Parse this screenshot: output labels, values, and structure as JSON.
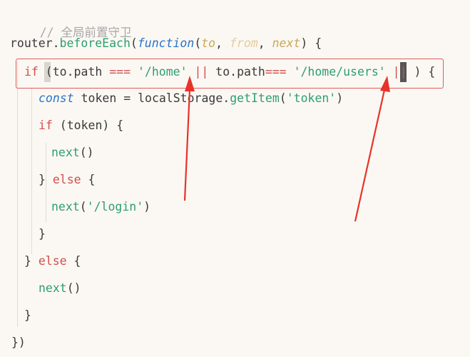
{
  "code": {
    "comment": "// 全局前置守卫",
    "line_router": {
      "obj": "router",
      "dot": ".",
      "method": "beforeEach",
      "open": "(",
      "fnkw": "function",
      "open2": "(",
      "p_to": "to",
      "comma1": ", ",
      "p_from": "from",
      "comma2": ", ",
      "p_next": "next",
      "close": ") {"
    },
    "line_if": {
      "kw": "if",
      "open": " (to.path ",
      "op1": "===",
      "sp1": " ",
      "s1": "'/home'",
      "sp2": " ",
      "or1": "||",
      "mid": " to.path",
      "op2": "===",
      "sp3": " ",
      "s2": "'/home/users'",
      "sp4": " ",
      "or2": "||",
      "close": " ) {"
    },
    "line_const": {
      "kw": "const",
      "rest": " token = localStorage.",
      "call": "getItem",
      "open": "(",
      "str": "'token'",
      "close": ")"
    },
    "line_if2": {
      "kw": "if",
      "rest": " (token) {"
    },
    "line_next1": {
      "call": "next",
      "rest": "()"
    },
    "line_else1": {
      "brace": "} ",
      "kw": "else",
      "rest": " {"
    },
    "line_next2": {
      "call": "next",
      "open": "(",
      "str": "'/login'",
      "close": ")"
    },
    "line_close1": "}",
    "line_else2": {
      "brace": "} ",
      "kw": "else",
      "rest": " {"
    },
    "line_next3": {
      "call": "next",
      "rest": "()"
    },
    "line_close2": "}",
    "line_close3": "})"
  },
  "annotation": {
    "box_color": "#e05a5a",
    "arrow_color": "#e8322a"
  }
}
